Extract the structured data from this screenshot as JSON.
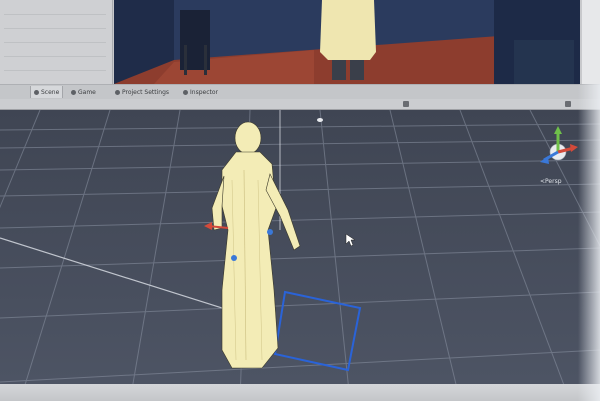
{
  "tabs": [
    {
      "label": "Scene",
      "icon": "scene-icon",
      "active": true
    },
    {
      "label": "Game",
      "icon": "game-icon",
      "active": false
    },
    {
      "label": "Project Settings",
      "icon": "settings-icon",
      "active": false
    },
    {
      "label": "Inspector",
      "icon": "inspector-icon",
      "active": false
    }
  ],
  "scene": {
    "gizmo_label": "<Persp"
  },
  "colors": {
    "grid_background": "#4a5160",
    "grid_lines": "#8b93a3",
    "statue": "#f3ecb6",
    "selection_box": "#2a63d8",
    "gizmo_red": "#d44a3a",
    "gizmo_green": "#6fc04a",
    "gizmo_blue": "#3a78d8"
  }
}
